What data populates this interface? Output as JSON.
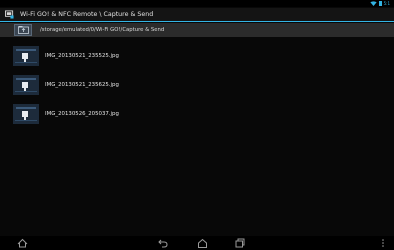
{
  "status_bar": {
    "clock": "5:1",
    "icons": [
      "wifi-icon",
      "battery-icon"
    ],
    "accent_color": "#33b5e5"
  },
  "action_bar": {
    "title": "Wi-Fi GO! & NFC Remote \\ Capture & Send",
    "icon": "app-logo-icon"
  },
  "path_bar": {
    "path": "/storage/emulated/0/Wi-Fi GO!/Capture & Send",
    "up_icon": "folder-up-icon"
  },
  "files": [
    {
      "name": "IMG_20130521_235525.jpg"
    },
    {
      "name": "IMG_20130521_235625.jpg"
    },
    {
      "name": "IMG_20130526_205037.jpg"
    }
  ],
  "nav_bar": {
    "buttons": [
      "home-icon",
      "back-icon",
      "home-outline-icon",
      "recent-apps-icon",
      "overflow-menu-icon"
    ]
  }
}
